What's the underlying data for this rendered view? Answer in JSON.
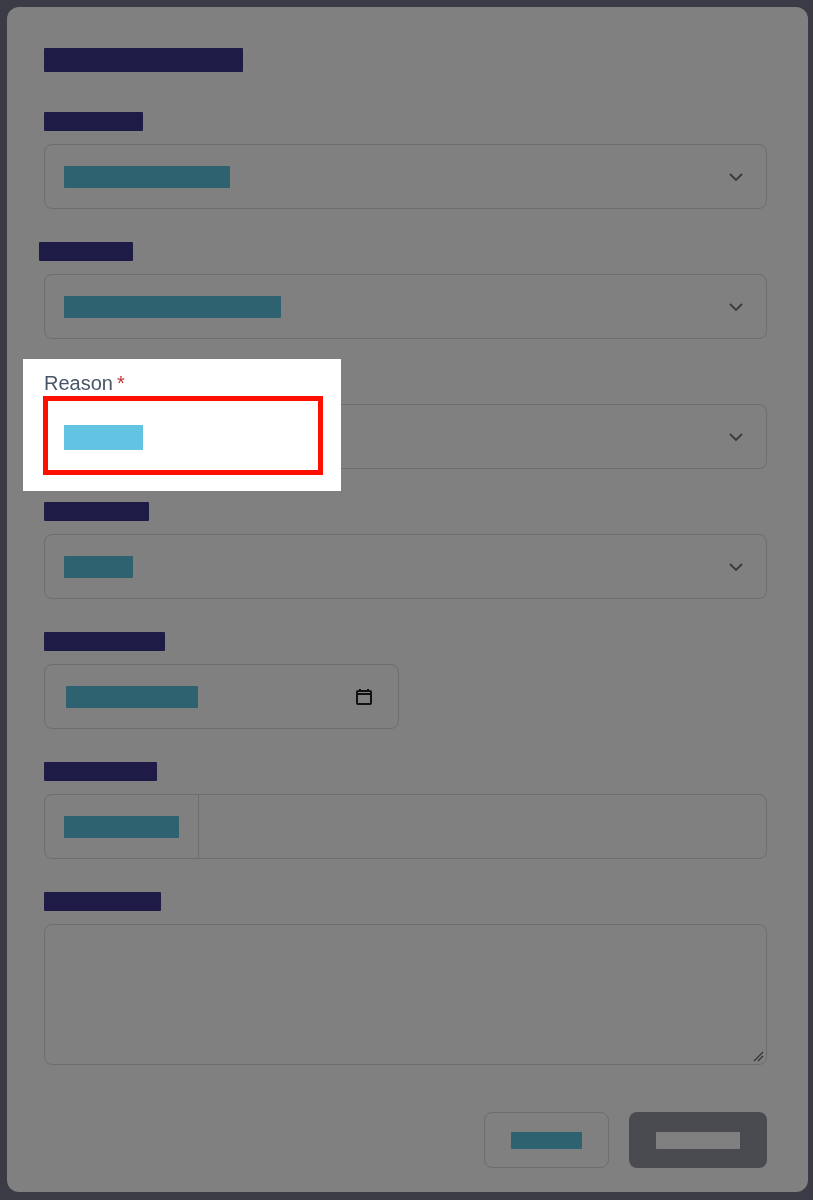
{
  "modal": {
    "fields": [
      {
        "kind": "select"
      },
      {
        "kind": "select"
      },
      {
        "kind": "select",
        "label": "Reason",
        "required_mark": "*",
        "highlighted": true
      },
      {
        "kind": "select"
      },
      {
        "kind": "date"
      },
      {
        "kind": "addon"
      },
      {
        "kind": "textarea"
      }
    ],
    "buttons": [
      {
        "kind": "secondary"
      },
      {
        "kind": "primary"
      }
    ]
  }
}
